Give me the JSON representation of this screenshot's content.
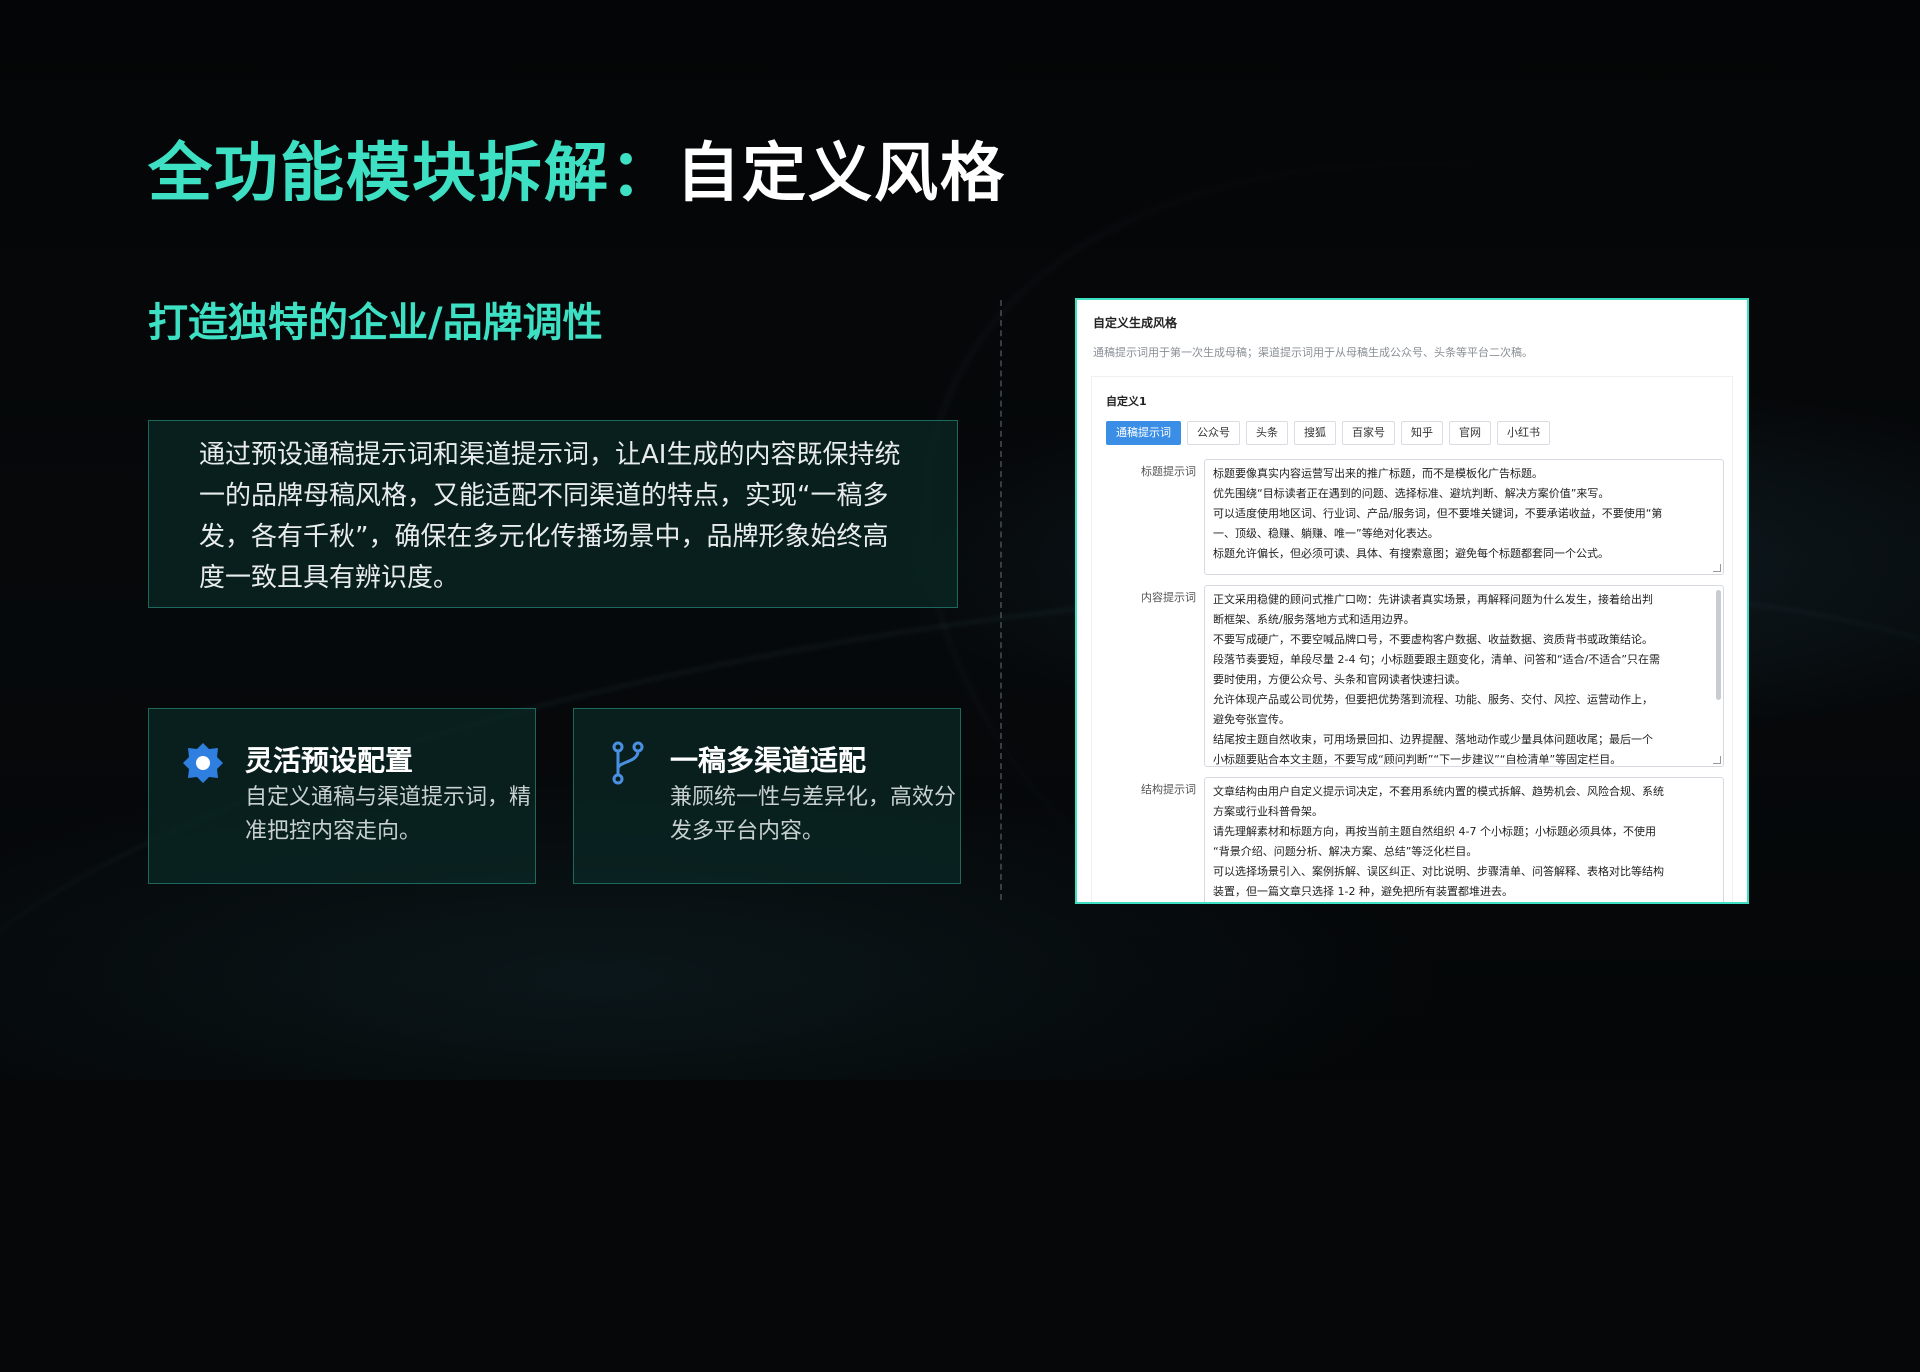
{
  "slide": {
    "title_accent": "全功能模块拆解：",
    "title_rest": "自定义风格",
    "subtitle": "打造独特的企业/品牌调性",
    "description": "通过预设通稿提示词和渠道提示词，让AI生成的内容既保持统一的品牌母稿风格，又能适配不同渠道的特点，实现“一稿多发，各有千秋”，确保在多元化传播场景中，品牌形象始终高度一致且具有辨识度。",
    "accent_color": "#3ee0c4",
    "cards": [
      {
        "icon": "gear-icon",
        "title": "灵活预设配置",
        "desc": "自定义通稿与渠道提示词，精准把控内容走向。"
      },
      {
        "icon": "branch-icon",
        "title": "一稿多渠道适配",
        "desc": "兼顾统一性与差异化，高效分发多平台内容。"
      }
    ]
  },
  "panel": {
    "title": "自定义生成风格",
    "hint": "通稿提示词用于第一次生成母稿；渠道提示词用于从母稿生成公众号、头条等平台二次稿。",
    "config_name": "自定义1",
    "tabs": [
      "通稿提示词",
      "公众号",
      "头条",
      "搜狐",
      "百家号",
      "知乎",
      "官网",
      "小红书"
    ],
    "active_tab": "通稿提示词",
    "fields": [
      {
        "label": "标题提示词",
        "lines": [
          "标题要像真实内容运营写出来的推广标题，而不是模板化广告标题。",
          "优先围绕“目标读者正在遇到的问题、选择标准、避坑判断、解决方案价值”来写。",
          "可以适度使用地区词、行业词、产品/服务词，但不要堆关键词，不要承诺收益，不要使用“第",
          "一、顶级、稳赚、躺赚、唯一”等绝对化表达。",
          "标题允许偏长，但必须可读、具体、有搜索意图；避免每个标题都套同一个公式。"
        ]
      },
      {
        "label": "内容提示词",
        "lines": [
          "正文采用稳健的顾问式推广口吻：先讲读者真实场景，再解释问题为什么发生，接着给出判",
          "断框架、系统/服务落地方式和适用边界。",
          "不要写成硬广，不要空喊品牌口号，不要虚构客户数据、收益数据、资质背书或政策结论。",
          "段落节奏要短，单段尽量 2-4 句；小标题要跟主题变化，清单、问答和“适合/不适合”只在需",
          "要时使用，方便公众号、头条和官网读者快速扫读。",
          "允许体现产品或公司优势，但要把优势落到流程、功能、服务、交付、风控、运营动作上，",
          "避免夸张宣传。",
          "结尾按主题自然收束，可用场景回扣、边界提醒、落地动作或少量具体问题收尾；最后一个",
          "小标题要贴合本文主题，不要写成“顾问判断”“下一步建议”“自检清单”等固定栏目。"
        ]
      },
      {
        "label": "结构提示词",
        "lines": [
          "文章结构由用户自定义提示词决定，不套用系统内置的模式拆解、趋势机会、风险合规、系统",
          "方案或行业科普骨架。",
          "请先理解素材和标题方向，再按当前主题自然组织 4-7 个小标题；小标题必须具体，不使用",
          "“背景介绍、问题分析、解决方案、总结”等泛化栏目。",
          "可以选择场景引入、案例拆解、误区纠正、对比说明、步骤清单、问答解释、表格对比等结构",
          "装置，但一篇文章只选择 1-2 种，避免把所有装置都堆进去。"
        ]
      }
    ]
  }
}
